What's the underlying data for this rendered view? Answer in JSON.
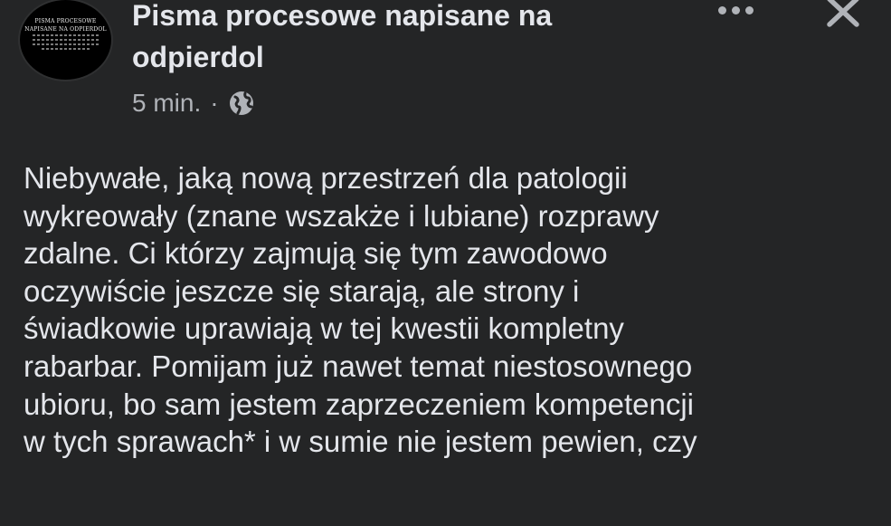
{
  "post": {
    "page_name_line1": "Pisma procesowe napisane na",
    "page_name_line2": "odpierdol",
    "timestamp": "5 min.",
    "separator": "·",
    "audience_icon": "globe-icon",
    "avatar": {
      "logo_line1": "PISMA PROCESOWE",
      "logo_line2": "NAPISANE NA ODPIERDOL"
    },
    "more_icon": "more-options-icon",
    "close_icon": "close-icon",
    "body_lines": [
      "Niebywałe, jaką nową przestrzeń dla patologii",
      "wykreowały (znane wszakże i lubiane) rozprawy",
      "zdalne. Ci którzy zajmują się tym zawodowo",
      "oczywiście jeszcze się starają, ale strony i",
      "świadkowie uprawiają w tej kwestii kompletny",
      "rabarbar. Pomijam już nawet temat niestosownego",
      "ubioru, bo sam jestem zaprzeczeniem kompetencji",
      "w tych sprawach* i w sumie nie jestem pewien, czy"
    ]
  },
  "colors": {
    "background": "#242526",
    "primary_text": "#e4e6eb",
    "secondary_text": "#b0b3b8"
  }
}
